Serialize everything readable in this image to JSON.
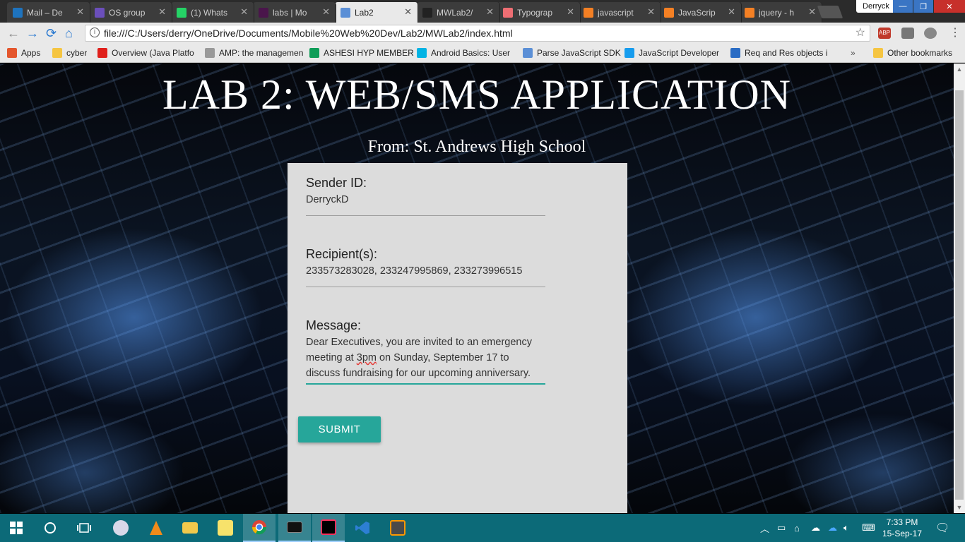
{
  "browser": {
    "tabs": [
      {
        "label": "Mail – De",
        "icon": "outlook-icon",
        "color": "#1e73be"
      },
      {
        "label": "OS group",
        "icon": "teams-icon",
        "color": "#6b4fbb"
      },
      {
        "label": "(1) Whats",
        "icon": "whatsapp-icon",
        "color": "#25d366"
      },
      {
        "label": "labs | Mo",
        "icon": "slack-icon",
        "color": "#4a154b"
      },
      {
        "label": "Lab2",
        "icon": "document-icon",
        "color": "#5b8fd6"
      },
      {
        "label": "MWLab2/",
        "icon": "github-icon",
        "color": "#222222"
      },
      {
        "label": "Typograp",
        "icon": "materialize-icon",
        "color": "#ee6e73"
      },
      {
        "label": "javascript",
        "icon": "stackoverflow-icon",
        "color": "#f48024"
      },
      {
        "label": "JavaScrip",
        "icon": "stackoverflow-icon",
        "color": "#f48024"
      },
      {
        "label": "jquery - h",
        "icon": "stackoverflow-icon",
        "color": "#f48024"
      }
    ],
    "active_tab": 4,
    "profile_name": "Derryck",
    "url": "file:///C:/Users/derry/OneDrive/Documents/Mobile%20Web%20Dev/Lab2/MWLab2/index.html",
    "bookmarks": [
      {
        "label": "Apps",
        "icon": "apps-grid-icon",
        "color": "#e4572e"
      },
      {
        "label": "cyber",
        "icon": "folder-icon",
        "color": "#f5c542"
      },
      {
        "label": "Overview (Java Platfo",
        "icon": "oracle-icon",
        "color": "#e0201b"
      },
      {
        "label": "AMP: the managemen",
        "icon": "amp-icon",
        "color": "#999999"
      },
      {
        "label": "ASHESI HYP MEMBER",
        "icon": "sheets-icon",
        "color": "#0f9d58"
      },
      {
        "label": "Android Basics: User",
        "icon": "udacity-icon",
        "color": "#02b3e4"
      },
      {
        "label": "Parse JavaScript SDK",
        "icon": "document-icon",
        "color": "#5b8fd6"
      },
      {
        "label": "JavaScript Developer",
        "icon": "parse-icon",
        "color": "#169cee"
      },
      {
        "label": "Req and Res objects i",
        "icon": "w-icon",
        "color": "#2a6cc4"
      }
    ],
    "more_bookmarks": "»",
    "other_bookmarks": "Other bookmarks"
  },
  "page": {
    "title": "LAB 2: WEB/SMS APPLICATION",
    "subtitle": "From: St. Andrews High School",
    "form": {
      "sender_label": "Sender ID:",
      "sender_value": "DerryckD",
      "recipients_label": "Recipient(s):",
      "recipients_value": "233573283028, 233247995869, 233273996515",
      "message_label": "Message:",
      "message_part1": "Dear Executives, you are invited to an emergency meeting at ",
      "message_misspelled": "3pm",
      "message_part2": " on Sunday, September 17 to discuss fundraising for our upcoming anniversary.",
      "submit_label": "SUBMIT",
      "accent_color": "#26a69a"
    }
  },
  "taskbar": {
    "time": "7:33 PM",
    "date": "15-Sep-17"
  }
}
